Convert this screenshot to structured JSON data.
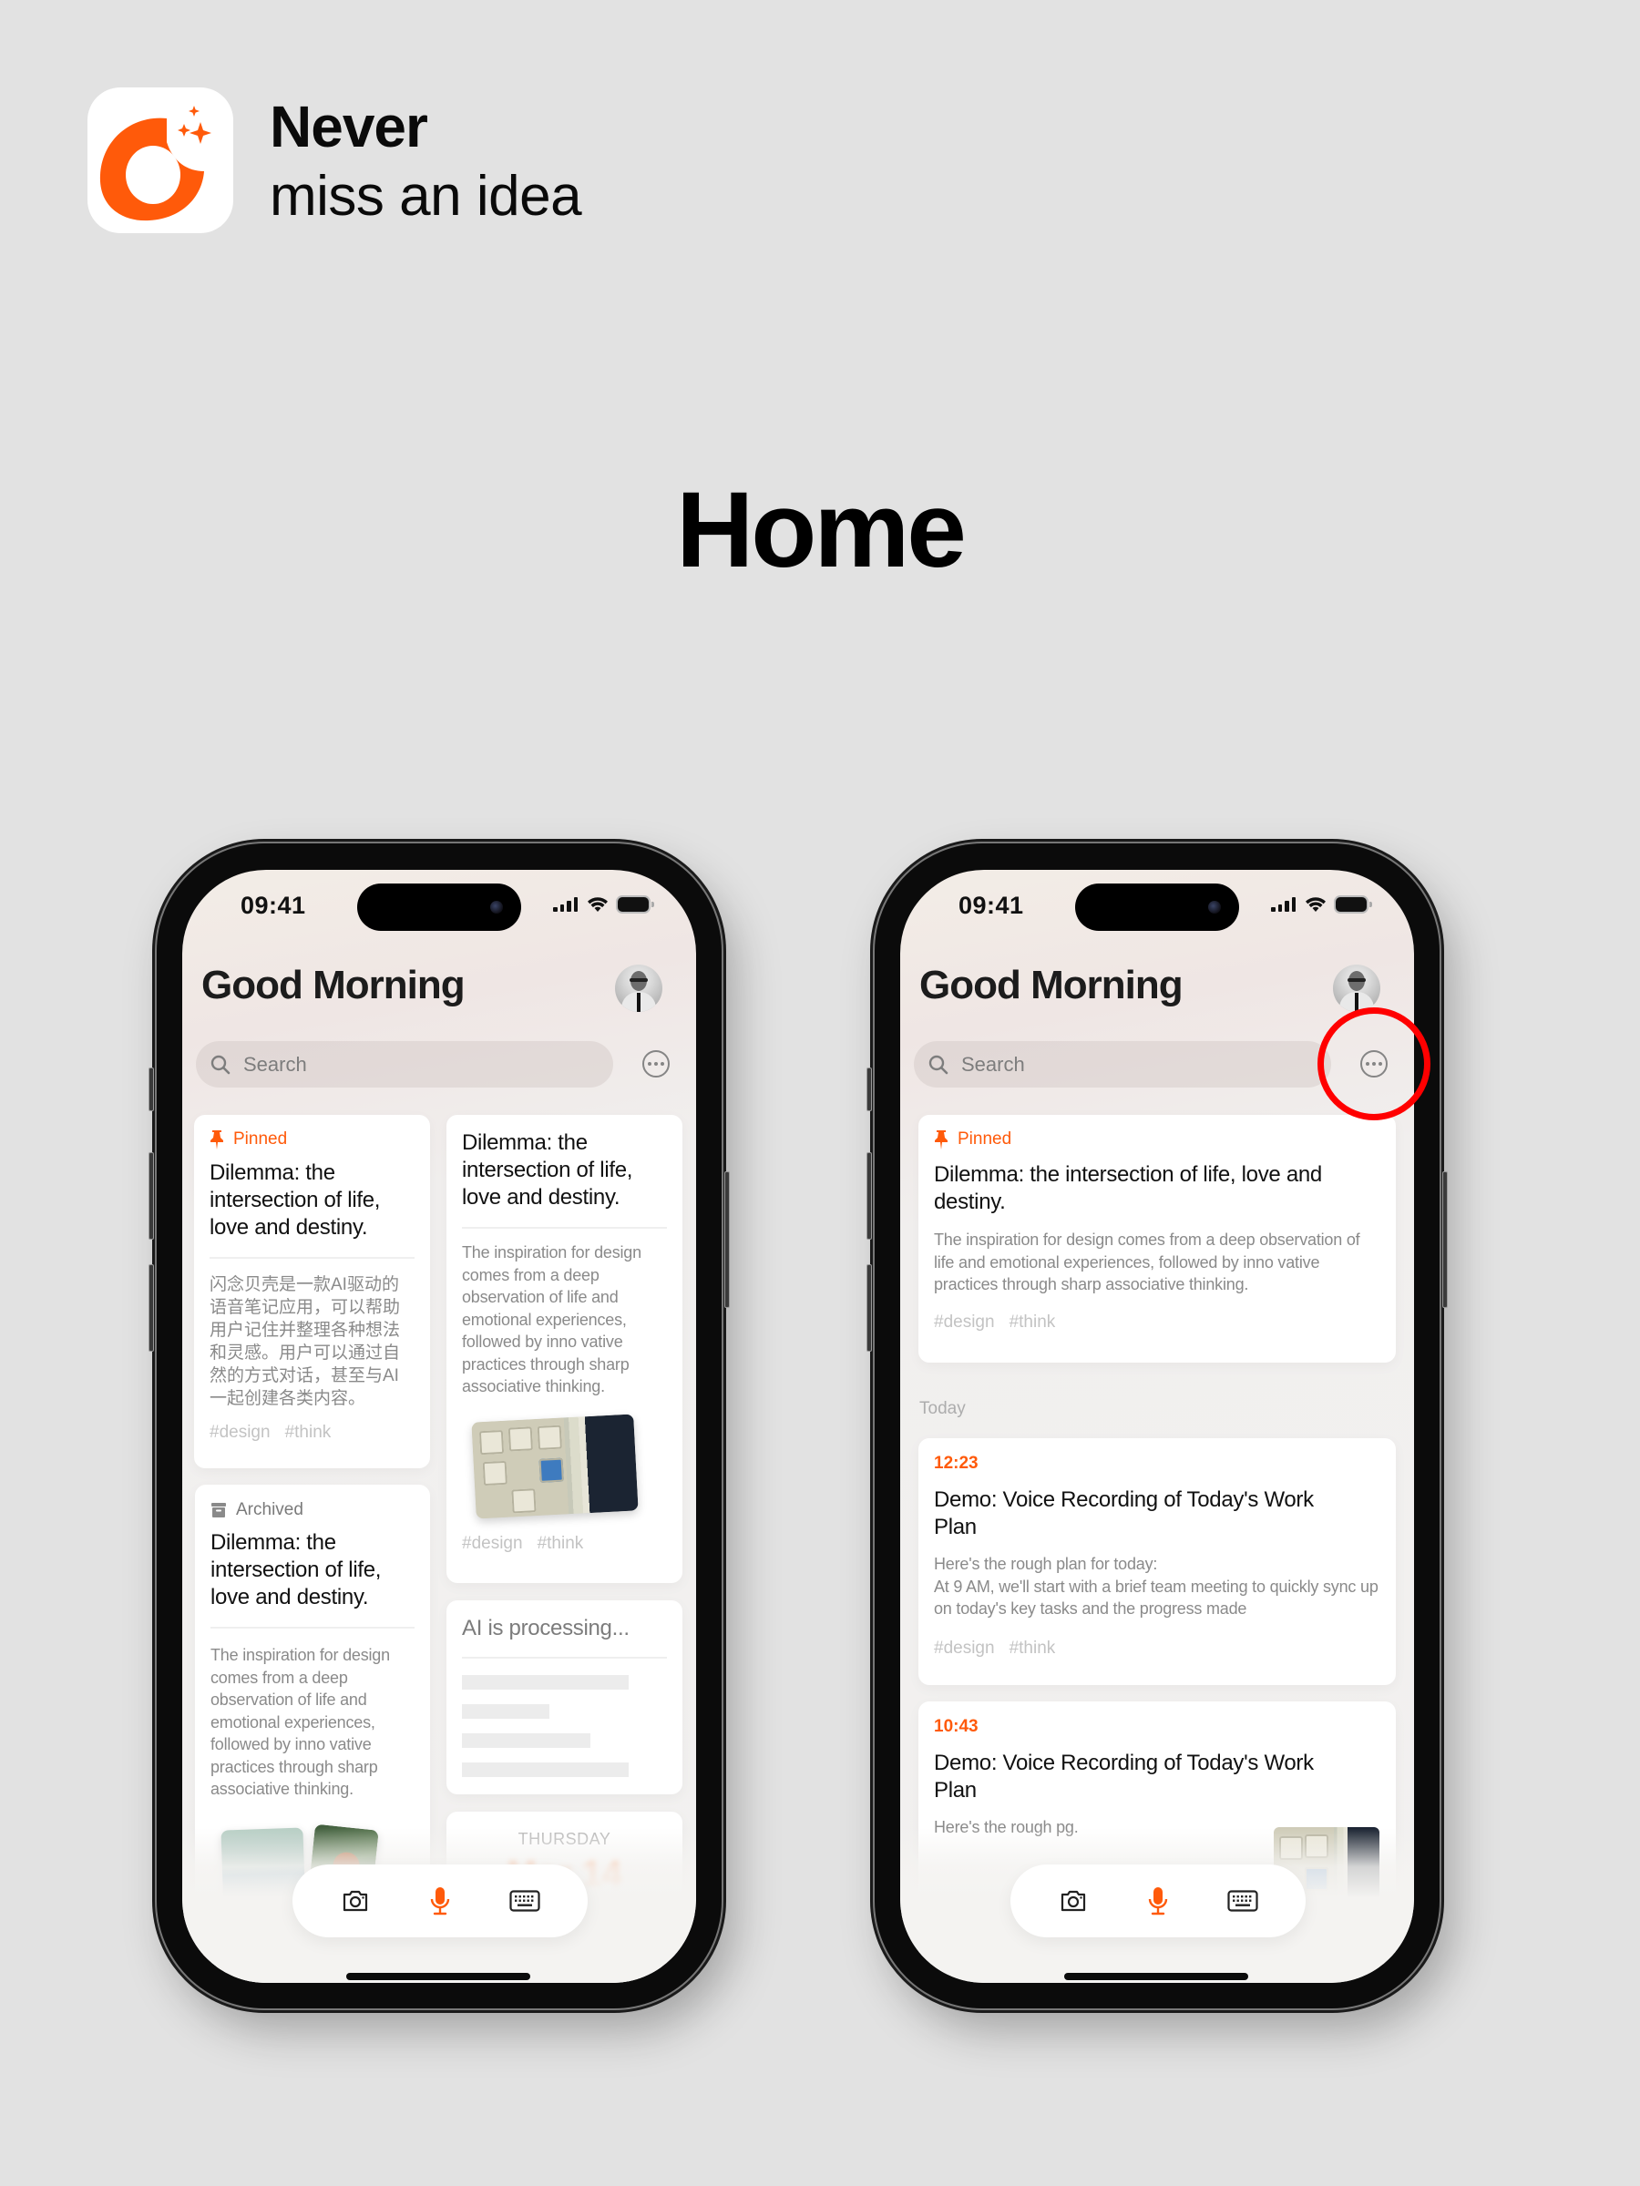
{
  "branding": {
    "app_icon": "app-logo-donut-sparkle-icon",
    "tagline_bold": "Never",
    "tagline_regular": "miss an idea",
    "accent_color": "#ff5a0a"
  },
  "section_title": "Home",
  "phones": [
    {
      "status_bar": {
        "time": "09:41",
        "icons": [
          "cellular-signal-icon",
          "wifi-icon",
          "battery-icon"
        ]
      },
      "header": {
        "greeting": "Good Morning",
        "avatar": "user-avatar"
      },
      "search": {
        "placeholder": "Search",
        "icon": "search-icon"
      },
      "more_button": {
        "icon": "more-options-icon"
      },
      "cards": [
        {
          "badge": "Pinned",
          "badge_icon": "pin-icon",
          "title": "Dilemma: the intersection of life, love and destiny.",
          "body": "闪念贝壳是一款AI驱动的语音笔记应用，可以帮助用户记住并整理各种想法和灵感。用户可以通过自然的方式对话，甚至与AI一起创建各类内容。",
          "tags": [
            "#design",
            "#think"
          ]
        },
        {
          "title": "Dilemma: the intersection of life, love and destiny.",
          "body": "The inspiration for design comes from a deep observation of life and emotional experiences, followed by inno vative practices through sharp associative thinking.",
          "image": "photo-shelf",
          "tags": [
            "#design",
            "#think"
          ]
        },
        {
          "badge": "Archived",
          "badge_icon": "archive-icon",
          "title": "Dilemma: the intersection of life, love and destiny.",
          "body": "The inspiration for design comes from a deep observation of life and emotional experiences, followed by inno vative practices through sharp associative thinking.",
          "images": [
            "photo-sea",
            "photo-forest"
          ]
        },
        {
          "title": "AI is processing...",
          "loading": true
        },
        {
          "day": "THURSDAY",
          "date": "Mar 14"
        }
      ],
      "toolbar": {
        "buttons": [
          "camera-icon",
          "microphone-icon",
          "keyboard-icon"
        ]
      }
    },
    {
      "status_bar": {
        "time": "09:41",
        "icons": [
          "cellular-signal-icon",
          "wifi-icon",
          "battery-icon"
        ]
      },
      "header": {
        "greeting": "Good Morning",
        "avatar": "user-avatar"
      },
      "search": {
        "placeholder": "Search",
        "icon": "search-icon"
      },
      "more_button": {
        "icon": "more-options-icon",
        "highlighted": true,
        "highlight_color": "#ff0000"
      },
      "pinned_card": {
        "badge": "Pinned",
        "badge_icon": "pin-icon",
        "title": "Dilemma: the intersection of life, love and destiny.",
        "body": "The inspiration for design comes from a deep observation of life and emotional experiences, followed by inno vative practices through sharp associative thinking.",
        "tags": [
          "#design",
          "#think"
        ]
      },
      "section_label": "Today",
      "notes": [
        {
          "time": "12:23",
          "title": "Demo: Voice Recording of Today's Work Plan",
          "body_line1": "Here's the rough plan for today:",
          "body_line2": "At 9 AM, we'll start with a brief team meeting to quickly sync up on today's key tasks and the progress made",
          "tags": [
            "#design",
            "#think"
          ]
        },
        {
          "time": "10:43",
          "title": "Demo: Voice Recording of Today's Work Plan",
          "body": "Here's the rough pg.",
          "image": "photo-shelf"
        }
      ],
      "toolbar": {
        "buttons": [
          "camera-icon",
          "microphone-icon",
          "keyboard-icon"
        ]
      }
    }
  ]
}
